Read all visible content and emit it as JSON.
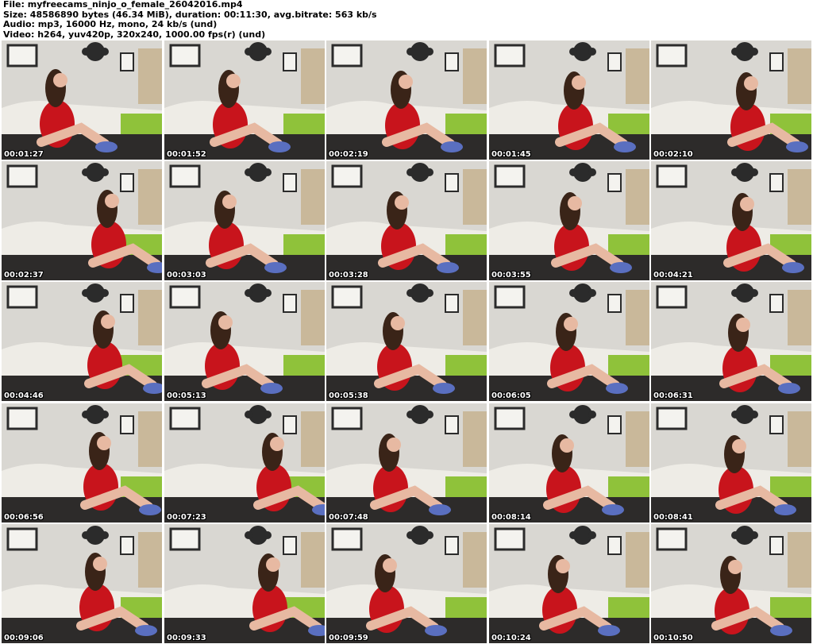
{
  "header": {
    "file_line": "File: myfreecams_ninjo_o_female_26042016.mp4",
    "size_line": "Size: 48586890 bytes (46.34 MiB), duration: 00:11:30, avg.bitrate: 563 kb/s",
    "audio_line": "Audio: mp3, 16000 Hz, mono, 24 kb/s (und)",
    "video_line": "Video: h264, yuv420p, 320x240, 1000.00 fps(r) (und)"
  },
  "thumbnails": [
    {
      "timestamp": "00:01:27"
    },
    {
      "timestamp": "00:01:52"
    },
    {
      "timestamp": "00:02:19"
    },
    {
      "timestamp": "00:01:45"
    },
    {
      "timestamp": "00:02:10"
    },
    {
      "timestamp": "00:02:37"
    },
    {
      "timestamp": "00:03:03"
    },
    {
      "timestamp": "00:03:28"
    },
    {
      "timestamp": "00:03:55"
    },
    {
      "timestamp": "00:04:21"
    },
    {
      "timestamp": "00:04:46"
    },
    {
      "timestamp": "00:05:13"
    },
    {
      "timestamp": "00:05:38"
    },
    {
      "timestamp": "00:06:05"
    },
    {
      "timestamp": "00:06:31"
    },
    {
      "timestamp": "00:06:56"
    },
    {
      "timestamp": "00:07:23"
    },
    {
      "timestamp": "00:07:48"
    },
    {
      "timestamp": "00:08:14"
    },
    {
      "timestamp": "00:08:41"
    },
    {
      "timestamp": "00:09:06"
    },
    {
      "timestamp": "00:09:33"
    },
    {
      "timestamp": "00:09:59"
    },
    {
      "timestamp": "00:10:24"
    },
    {
      "timestamp": "00:10:50"
    }
  ],
  "colors": {
    "wall": "#d9d7d2",
    "sofa": "#eeece6",
    "cushion": "#8fc23a",
    "shirt": "#c8141c",
    "hair": "#3a2418",
    "skin": "#e7b9a2",
    "sock": "#5a6fc0",
    "frame_dark": "#2b2b2b",
    "floor": "#2d2b2a"
  }
}
